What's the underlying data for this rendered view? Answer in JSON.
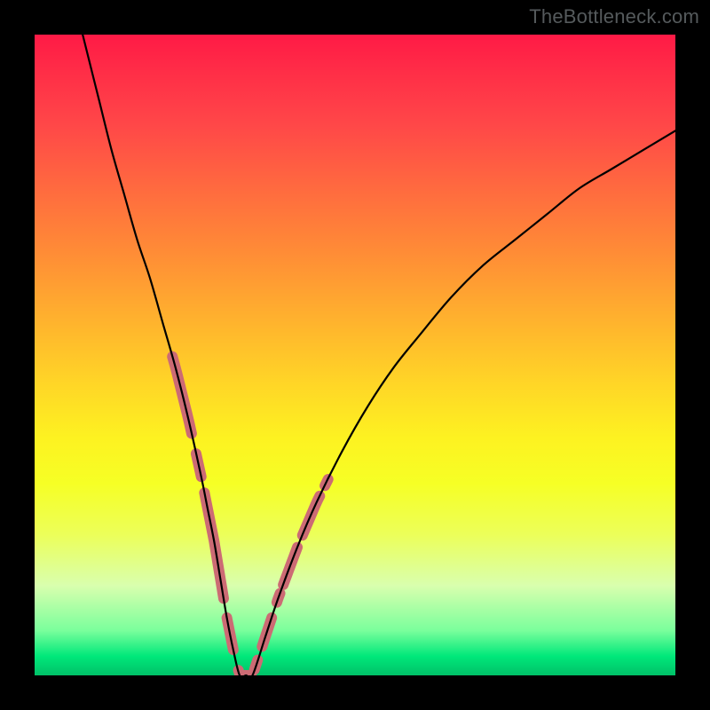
{
  "watermark": "TheBottleneck.com",
  "colors": {
    "dot": "#cc6b74",
    "curve": "#000000",
    "gradient_top": "#ff1a46",
    "gradient_bottom": "#00c168"
  },
  "chart_data": {
    "type": "line",
    "title": "",
    "xlabel": "",
    "ylabel": "",
    "xlim": [
      0,
      100
    ],
    "ylim": [
      0,
      100
    ],
    "x": [
      7.5,
      10,
      12,
      14,
      16,
      18,
      20,
      22,
      24,
      26,
      27,
      28,
      29,
      30,
      31,
      32,
      33,
      34,
      36,
      38,
      41,
      44,
      48,
      52,
      56,
      60,
      65,
      70,
      75,
      80,
      85,
      90,
      95,
      100
    ],
    "values": [
      100,
      90,
      82,
      75,
      68,
      62,
      55,
      48,
      40,
      31,
      26,
      21,
      15,
      9,
      4,
      0,
      0,
      0,
      6,
      12,
      20,
      27,
      35,
      42,
      48,
      53,
      59,
      64,
      68,
      72,
      76,
      79,
      82,
      85
    ],
    "series": [
      {
        "name": "bottleneck-curve",
        "x": [
          7.5,
          10,
          12,
          14,
          16,
          18,
          20,
          22,
          24,
          26,
          27,
          28,
          29,
          30,
          31,
          32,
          33,
          34,
          36,
          38,
          41,
          44,
          48,
          52,
          56,
          60,
          65,
          70,
          75,
          80,
          85,
          90,
          95,
          100
        ],
        "values": [
          100,
          90,
          82,
          75,
          68,
          62,
          55,
          48,
          40,
          31,
          26,
          21,
          15,
          9,
          4,
          0,
          0,
          0,
          6,
          12,
          20,
          27,
          35,
          42,
          48,
          53,
          59,
          64,
          68,
          72,
          76,
          79,
          82,
          85
        ]
      }
    ],
    "highlight_segments": [
      {
        "x0": 21.5,
        "x1": 24.5
      },
      {
        "x0": 25.2,
        "x1": 26.0
      },
      {
        "x0": 26.5,
        "x1": 29.5
      },
      {
        "x0": 30.0,
        "x1": 31.0
      },
      {
        "x0": 31.8,
        "x1": 33.8
      },
      {
        "x0": 34.3,
        "x1": 34.8
      },
      {
        "x0": 35.5,
        "x1": 37.0
      },
      {
        "x0": 37.8,
        "x1": 38.3
      },
      {
        "x0": 38.8,
        "x1": 41.0
      },
      {
        "x0": 41.8,
        "x1": 44.5
      },
      {
        "x0": 45.3,
        "x1": 45.8
      }
    ]
  }
}
